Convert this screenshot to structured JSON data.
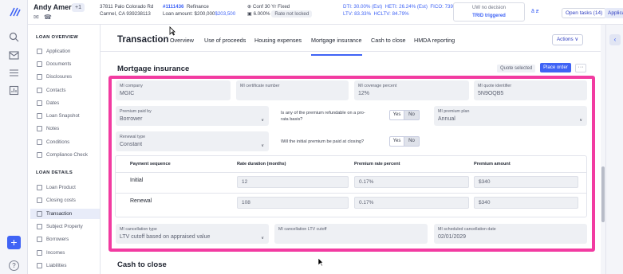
{
  "header": {
    "borrower_name": "Andy America",
    "co_borrower_count": "+1",
    "address_line1": "37811 Palo Colorado Rd",
    "address_line2": "Carmel, CA 939238113",
    "loan_number": "#1111436",
    "loan_purpose": "Refinance",
    "loan_amount_label": "Loan amount: $200,000",
    "loan_amount_link": "$203,500",
    "product": "Conf 30 Yr Fixed",
    "rate": "6.000%",
    "rate_status": "Rate not locked",
    "dti": "DTI: 30.00% (Est)",
    "heti": "HETI: 26.24% (Est)",
    "fico": "FICO: 739",
    "ltv": "LTV: 83.33%",
    "hcltv": "HCLTV: 84.79%",
    "uw_status": "UW no decision",
    "trid": "TRID triggered",
    "hi_badge": "ā ƶ",
    "open_tasks": "Open tasks (14)",
    "application": "Application",
    "more": "···"
  },
  "sidebar": {
    "loan_overview": "LOAN OVERVIEW",
    "overview_items": [
      {
        "label": "Application"
      },
      {
        "label": "Documents"
      },
      {
        "label": "Disclosures"
      },
      {
        "label": "Contacts"
      },
      {
        "label": "Dates"
      },
      {
        "label": "Loan Snapshot"
      },
      {
        "label": "Notes"
      },
      {
        "label": "Conditions"
      },
      {
        "label": "Compliance Check"
      }
    ],
    "loan_details": "LOAN DETAILS",
    "detail_items": [
      {
        "label": "Loan Product"
      },
      {
        "label": "Closing costs"
      },
      {
        "label": "Transaction"
      },
      {
        "label": "Subject Property"
      },
      {
        "label": "Borrowers"
      },
      {
        "label": "Incomes"
      },
      {
        "label": "Liabilities"
      }
    ]
  },
  "main": {
    "page_title": "Transaction",
    "tabs": [
      {
        "label": "Overview"
      },
      {
        "label": "Use of proceeds"
      },
      {
        "label": "Housing expenses"
      },
      {
        "label": "Mortgage insurance"
      },
      {
        "label": "Cash to close"
      },
      {
        "label": "HMDA reporting"
      }
    ],
    "actions_label": "Actions ∨",
    "section_title": "Mortgage insurance",
    "quote_selected": "Quote selected",
    "place_order": "Place order",
    "more": "···",
    "mi_company": {
      "label": "MI company",
      "value": "MGIC"
    },
    "mi_cert": {
      "label": "MI certificate number",
      "value": ""
    },
    "mi_coverage": {
      "label": "MI coverage percent",
      "value": "12%"
    },
    "mi_quote": {
      "label": "MI quote identifier",
      "value": "5N9OQB5"
    },
    "premium_paid_by": {
      "label": "Premium paid by",
      "value": "Borrower"
    },
    "refundable_q": "Is any of the premium refundable on a pro-rata basis?",
    "yes": "Yes",
    "no": "No",
    "premium_plan": {
      "label": "MI premium plan",
      "value": "Annual"
    },
    "renewal_type": {
      "label": "Renewal type",
      "value": "Constant"
    },
    "initial_paid_q": "Will the initial premium be paid at closing?",
    "table": {
      "headers": [
        "Payment sequence",
        "Rate duration (months)",
        "Premium rate percent",
        "Premium amount"
      ],
      "rows": [
        {
          "seq": "Initial",
          "duration": "12",
          "rate": "0.17%",
          "amount": "$340"
        },
        {
          "seq": "Renewal",
          "duration": "108",
          "rate": "0.17%",
          "amount": "$340"
        }
      ]
    },
    "cancel_type": {
      "label": "MI cancellation type",
      "value": "LTV cutoff based on appraised value"
    },
    "cancel_ltv": {
      "label": "MI cancellation LTV cutoff",
      "value": ""
    },
    "cancel_date": {
      "label": "MI scheduled cancellation date",
      "value": "02/01/2029"
    },
    "next_section": "Cash to close"
  },
  "colors": {
    "accent": "#3f63f5",
    "highlight": "#f23ba1"
  }
}
